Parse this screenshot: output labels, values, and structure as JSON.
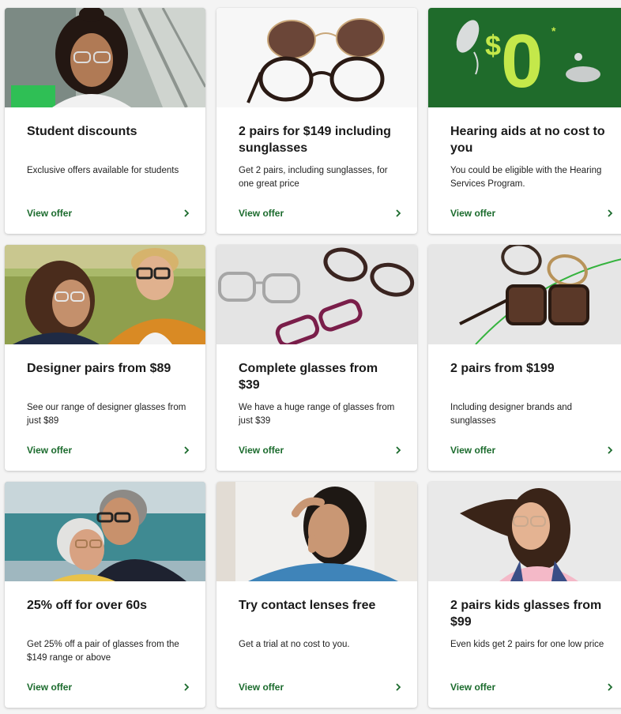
{
  "accent_color": "#1b6b2d",
  "cards": [
    {
      "title": "Student discounts",
      "desc": "Exclusive offers available for students",
      "cta": "View offer",
      "image": "student-photo",
      "icon": "chevron-right-icon"
    },
    {
      "title": "2 pairs for $149 including sunglasses",
      "desc": "Get 2 pairs, including sunglasses, for one great price",
      "cta": "View offer",
      "image": "sunglasses-photo",
      "icon": "chevron-right-icon"
    },
    {
      "title": "Hearing aids at no cost to you",
      "desc": "You could be eligible with the Hearing Services Program.",
      "cta": "View offer",
      "image": "hearing-aids-promo",
      "promo_text": "$0",
      "promo_footnote": "*",
      "icon": "chevron-right-icon"
    },
    {
      "title": "Designer pairs from $89",
      "desc": "See our range of designer glasses from just $89",
      "cta": "View offer",
      "image": "couple-photo",
      "icon": "chevron-right-icon"
    },
    {
      "title": "Complete glasses from $39",
      "desc": "We have a huge range of glasses from just $39",
      "cta": "View offer",
      "image": "glasses-flatlay-photo",
      "icon": "chevron-right-icon"
    },
    {
      "title": "2 pairs from $199",
      "desc": "Including designer brands and sunglasses",
      "cta": "View offer",
      "image": "designer-frames-photo",
      "icon": "chevron-right-icon"
    },
    {
      "title": "25% off for over 60s",
      "desc": "Get 25% off a pair of glasses from the $149 range or above",
      "cta": "View offer",
      "image": "senior-couple-photo",
      "icon": "chevron-right-icon"
    },
    {
      "title": "Try contact lenses free",
      "desc": "Get a trial at no cost to you.",
      "cta": "View offer",
      "image": "contact-lens-photo",
      "icon": "chevron-right-icon"
    },
    {
      "title": "2 pairs kids glasses from $99",
      "desc": "Even kids get 2 pairs for one low price",
      "cta": "View offer",
      "image": "kid-photo",
      "icon": "chevron-right-icon"
    }
  ]
}
